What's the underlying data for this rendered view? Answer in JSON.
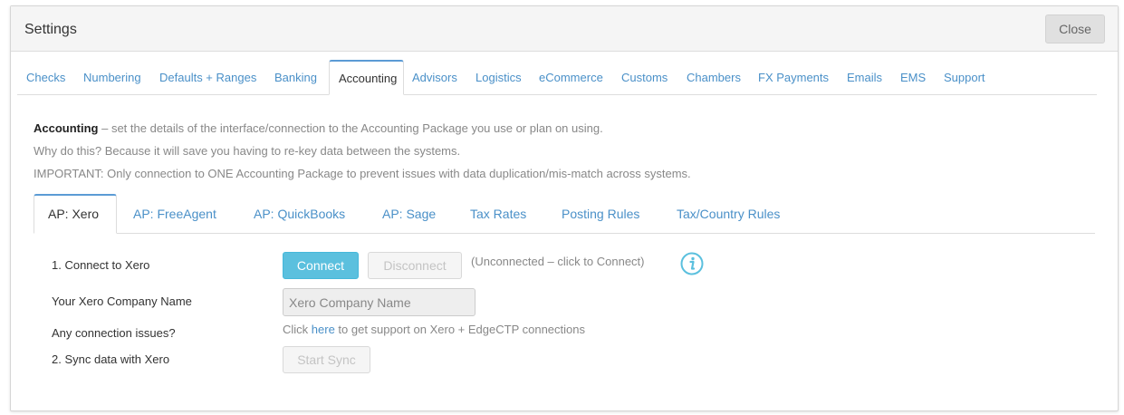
{
  "header": {
    "title": "Settings",
    "close_label": "Close"
  },
  "main_tabs": [
    {
      "label": "Checks"
    },
    {
      "label": "Numbering"
    },
    {
      "label": "Defaults + Ranges"
    },
    {
      "label": "Banking"
    },
    {
      "label": "Accounting",
      "active": true
    },
    {
      "label": "Advisors"
    },
    {
      "label": "Logistics"
    },
    {
      "label": "eCommerce"
    },
    {
      "label": "Customs"
    },
    {
      "label": "Chambers"
    },
    {
      "label": "FX Payments"
    },
    {
      "label": "Emails"
    },
    {
      "label": "EMS"
    },
    {
      "label": "Support"
    }
  ],
  "intro": {
    "heading": "Accounting",
    "line1_rest": " – set the details of the interface/connection to the Accounting Package you use or plan on using.",
    "line2": "Why do this? Because it will save you having to re-key data between the systems.",
    "line3": "IMPORTANT: Only connection to ONE Accounting Package to prevent issues with data duplication/mis-match across systems."
  },
  "sub_tabs": [
    {
      "label": "AP: Xero",
      "active": true
    },
    {
      "label": "AP: FreeAgent"
    },
    {
      "label": "AP: QuickBooks"
    },
    {
      "label": "AP: Sage"
    },
    {
      "label": "Tax Rates"
    },
    {
      "label": "Posting Rules"
    },
    {
      "label": "Tax/Country Rules"
    }
  ],
  "xero": {
    "connect_label": "1. Connect to Xero",
    "connect_button": "Connect",
    "disconnect_button": "Disconnect",
    "status": "(Unconnected – click to Connect)",
    "company_label": "Your Xero Company Name",
    "company_placeholder": "Xero Company Name",
    "issues_label": "Any connection issues?",
    "help_prefix": "Click ",
    "help_link": "here",
    "help_suffix": " to get support on Xero + EdgeCTP connections",
    "sync_label": "2. Sync data with Xero",
    "sync_button": "Start Sync"
  },
  "colors": {
    "link": "#4a90c8",
    "accent": "#5bc0de",
    "active_tab_border": "#5b9bd5"
  },
  "icons": {
    "info": "info-circle-icon"
  }
}
